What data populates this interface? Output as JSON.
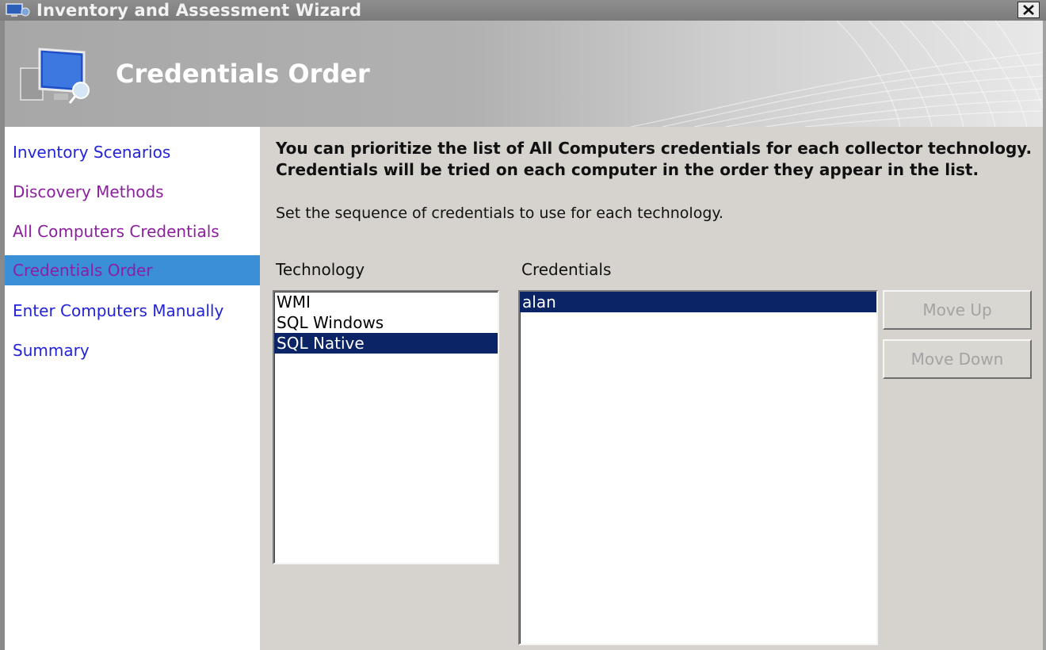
{
  "window": {
    "title": "Inventory and Assessment Wizard",
    "close_glyph": "✕",
    "icon": "computer-icon"
  },
  "header": {
    "title": "Credentials Order",
    "icon": "monitor-icon"
  },
  "sidebar": {
    "items": [
      {
        "label": "Inventory Scenarios",
        "state": "link"
      },
      {
        "label": "Discovery Methods",
        "state": "visited"
      },
      {
        "label": "All Computers Credentials",
        "state": "visited"
      },
      {
        "label": "Credentials Order",
        "state": "active"
      },
      {
        "label": "Enter Computers Manually",
        "state": "link"
      },
      {
        "label": "Summary",
        "state": "link"
      }
    ]
  },
  "main": {
    "intro_line1": "You can prioritize the list of All Computers credentials for each collector technology.",
    "intro_line2": "Credentials will be tried on each computer in the order they appear in the list.",
    "instruction": "Set the sequence of credentials to use for each technology.",
    "technology_label": "Technology",
    "credentials_label": "Credentials",
    "technologies": [
      {
        "label": "WMI",
        "selected": false
      },
      {
        "label": "SQL Windows",
        "selected": false
      },
      {
        "label": "SQL Native",
        "selected": true
      }
    ],
    "credentials": [
      {
        "label": "alan",
        "selected": true
      }
    ],
    "move_up_label": "Move Up",
    "move_down_label": "Move Down"
  },
  "colors": {
    "selection": "#0b2466",
    "nav_active_bg": "#3a8fd6",
    "link": "#2323d8",
    "visited": "#8c1f9e",
    "dialog_bg": "#d6d3ce"
  }
}
